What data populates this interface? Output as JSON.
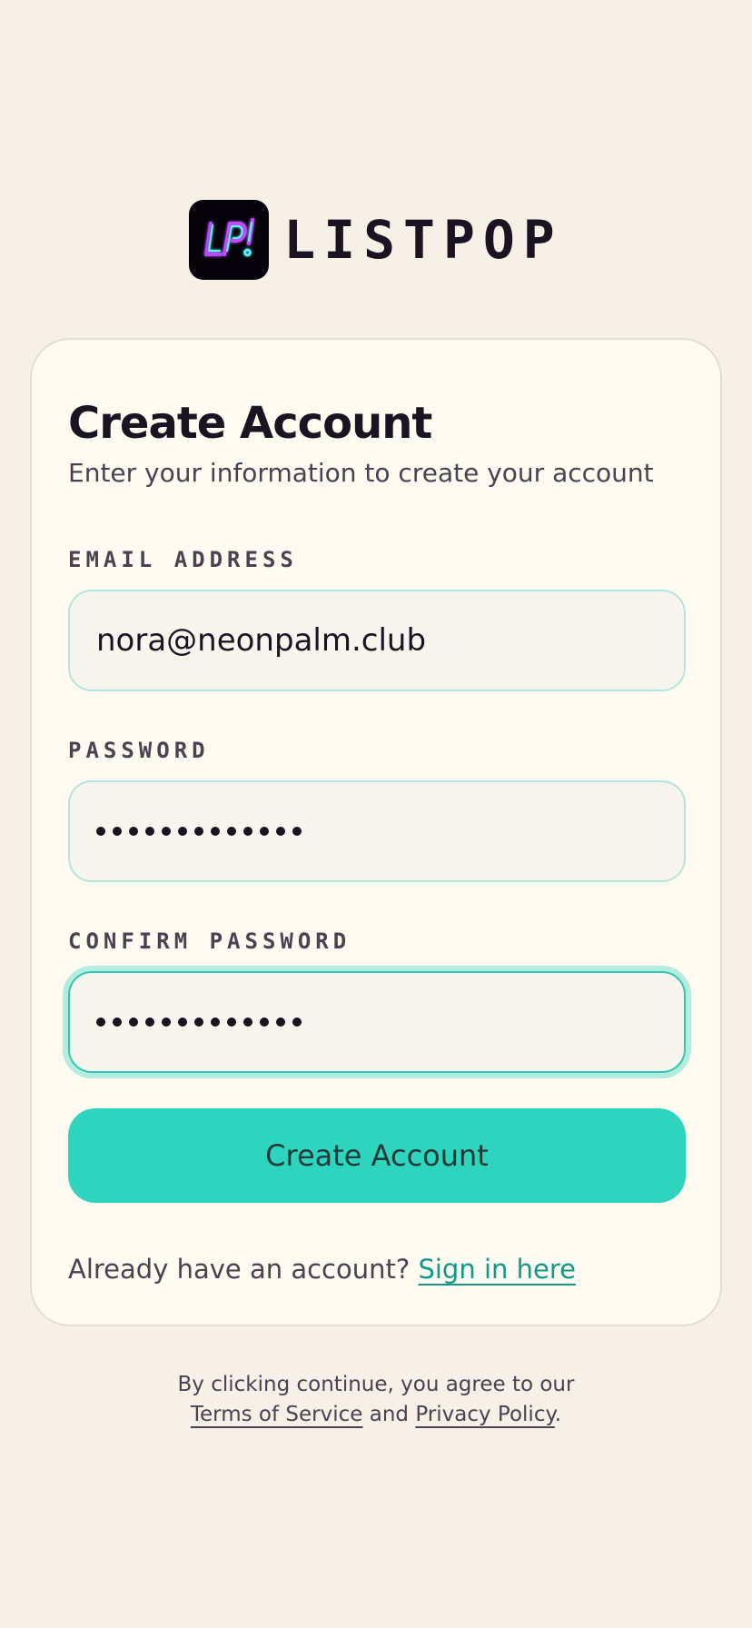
{
  "brand": {
    "name": "LISTPOP",
    "logo_text": "LP!",
    "logo_icon": "neon-lp-logo"
  },
  "form": {
    "title": "Create Account",
    "subtitle": "Enter your information to create your account",
    "email": {
      "label": "EMAIL ADDRESS",
      "value": "nora@neonpalm.club"
    },
    "password": {
      "label": "PASSWORD",
      "masked_length": 13
    },
    "confirm_password": {
      "label": "CONFIRM PASSWORD",
      "masked_length": 13,
      "focused": true
    },
    "submit_label": "Create Account",
    "signin_prompt": "Already have an account?",
    "signin_link": "Sign in here"
  },
  "legal": {
    "line1": "By clicking continue, you agree to our",
    "terms_link": "Terms of Service",
    "and_text": "and",
    "privacy_link": "Privacy Policy",
    "period": "."
  },
  "colors": {
    "background": "#f6f0e6",
    "card": "#fffbf0",
    "accent": "#2ed4bd",
    "link": "#13998a",
    "field_border": "#b3e6dc",
    "text_dark": "#1a1321"
  }
}
